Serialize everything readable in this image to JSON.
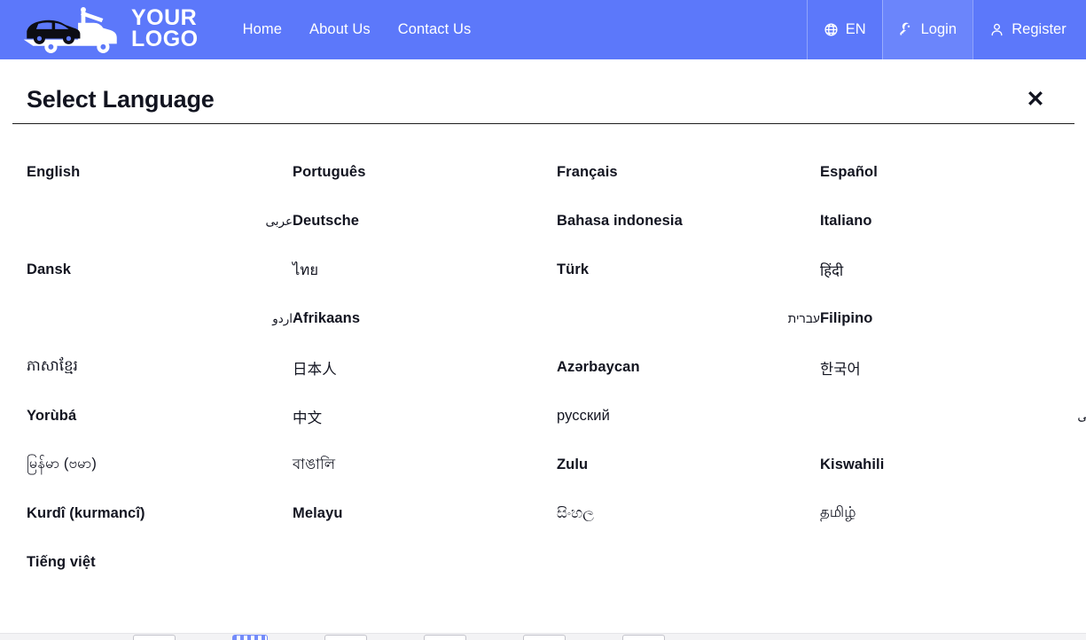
{
  "header": {
    "logo": {
      "icon": "tow-truck-icon",
      "line1": "YOUR",
      "line2": "LOGO"
    },
    "nav": [
      {
        "label": "Home"
      },
      {
        "label": "About Us"
      },
      {
        "label": "Contact Us"
      }
    ],
    "actions": {
      "language": {
        "icon": "globe-icon",
        "label": "EN"
      },
      "login": {
        "icon": "key-icon",
        "label": "Login"
      },
      "register": {
        "icon": "user-icon",
        "label": "Register"
      }
    },
    "colors": {
      "background": "#5c78fa",
      "active_cell": "#6b85fb",
      "text": "#ffffff"
    }
  },
  "modal": {
    "title": "Select Language",
    "close_label": "✕",
    "text_color": "#121420",
    "languages": [
      {
        "label": "English",
        "dir": "ltr",
        "script": "latin"
      },
      {
        "label": "Português",
        "dir": "ltr",
        "script": "latin"
      },
      {
        "label": "Français",
        "dir": "ltr",
        "script": "latin"
      },
      {
        "label": "Español",
        "dir": "ltr",
        "script": "latin"
      },
      {
        "label": "عربى",
        "dir": "rtl",
        "script": "arabic"
      },
      {
        "label": "Deutsche",
        "dir": "ltr",
        "script": "latin"
      },
      {
        "label": "Bahasa indonesia",
        "dir": "ltr",
        "script": "latin"
      },
      {
        "label": "Italiano",
        "dir": "ltr",
        "script": "latin"
      },
      {
        "label": "Dansk",
        "dir": "ltr",
        "script": "latin"
      },
      {
        "label": "ไทย",
        "dir": "ltr",
        "script": "thai"
      },
      {
        "label": "Türk",
        "dir": "ltr",
        "script": "latin"
      },
      {
        "label": "हिंदी",
        "dir": "ltr",
        "script": "devanagari"
      },
      {
        "label": "اردو",
        "dir": "rtl",
        "script": "arabic"
      },
      {
        "label": "Afrikaans",
        "dir": "ltr",
        "script": "latin"
      },
      {
        "label": "עברית",
        "dir": "rtl",
        "script": "hebrew"
      },
      {
        "label": "Filipino",
        "dir": "ltr",
        "script": "latin"
      },
      {
        "label": "ភាសាខ្មែរ",
        "dir": "ltr",
        "script": "khmer"
      },
      {
        "label": "日本人",
        "dir": "ltr",
        "script": "japanese"
      },
      {
        "label": "Azərbaycan",
        "dir": "ltr",
        "script": "latin"
      },
      {
        "label": "한국어",
        "dir": "ltr",
        "script": "korean"
      },
      {
        "label": "Yorùbá",
        "dir": "ltr",
        "script": "latin"
      },
      {
        "label": "中文",
        "dir": "ltr",
        "script": "chinese"
      },
      {
        "label": "русский",
        "dir": "ltr",
        "script": "cyrillic"
      },
      {
        "label": "فارسی",
        "dir": "rtl",
        "script": "arabic"
      },
      {
        "label": "မြန်မာ (ဗမာ)",
        "dir": "ltr",
        "script": "burmese"
      },
      {
        "label": "বাঙালি",
        "dir": "ltr",
        "script": "bengali"
      },
      {
        "label": "Zulu",
        "dir": "ltr",
        "script": "latin"
      },
      {
        "label": "Kiswahili",
        "dir": "ltr",
        "script": "latin"
      },
      {
        "label": "Kurdî (kurmancî)",
        "dir": "ltr",
        "script": "latin"
      },
      {
        "label": "Melayu",
        "dir": "ltr",
        "script": "latin"
      },
      {
        "label": "සිංහල",
        "dir": "ltr",
        "script": "sinhala"
      },
      {
        "label": "தமிழ்",
        "dir": "ltr",
        "script": "tamil"
      },
      {
        "label": "Tiếng việt",
        "dir": "ltr",
        "script": "latin"
      }
    ]
  }
}
